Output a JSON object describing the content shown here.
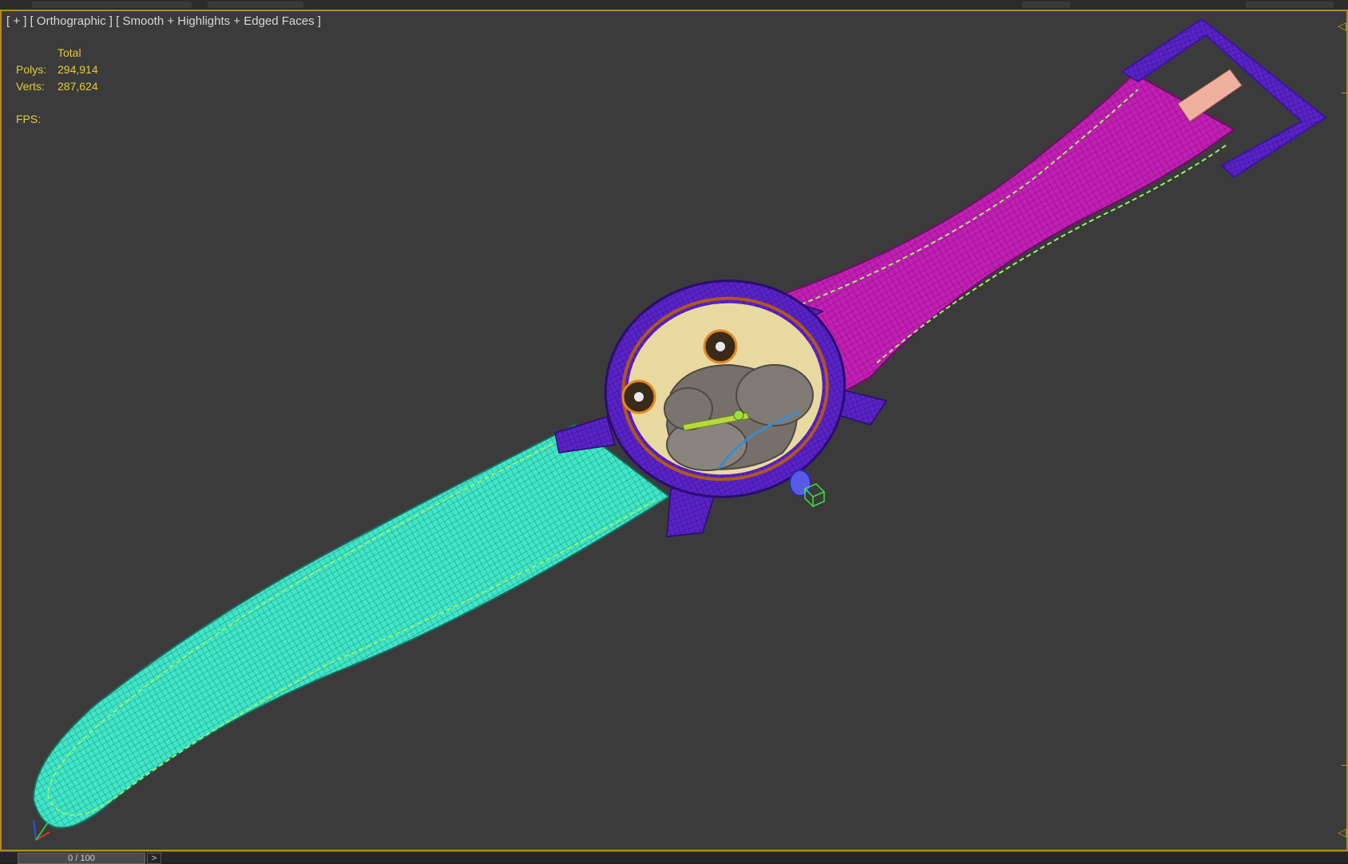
{
  "viewport": {
    "label": "[ + ] [ Orthographic ] [ Smooth + Highlights + Edged Faces ]"
  },
  "stats": {
    "header": "Total",
    "polys_label": "Polys:",
    "polys_value": "294,914",
    "verts_label": "Verts:",
    "verts_value": "287,624",
    "fps_label": "FPS:"
  },
  "timeline": {
    "frame_display": "0 / 100",
    "next_label": ">"
  },
  "colors": {
    "strap_long": "#3fe6c8",
    "strap_short": "#c21fb4",
    "case": "#5a23c8",
    "dial": "#e8d9a0",
    "viewport_border": "#b08a2a",
    "stats_text": "#e1cc3a"
  }
}
